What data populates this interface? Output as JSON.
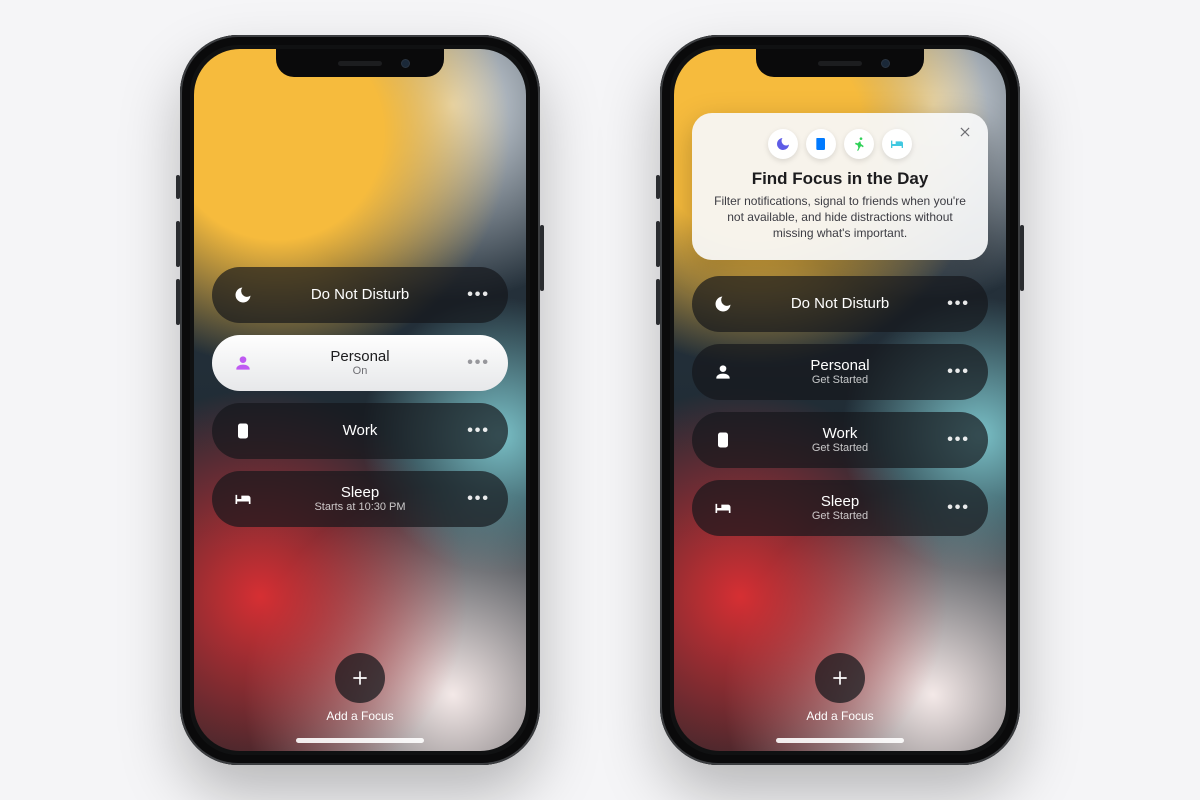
{
  "left": {
    "items": [
      {
        "title": "Do Not Disturb",
        "sub": ""
      },
      {
        "title": "Personal",
        "sub": "On"
      },
      {
        "title": "Work",
        "sub": ""
      },
      {
        "title": "Sleep",
        "sub": "Starts at 10:30 PM"
      }
    ],
    "add": "Add a Focus"
  },
  "right": {
    "card": {
      "title": "Find Focus in the Day",
      "body": "Filter notifications, signal to friends when you're not available, and hide distractions without missing what's important."
    },
    "items": [
      {
        "title": "Do Not Disturb",
        "sub": ""
      },
      {
        "title": "Personal",
        "sub": "Get Started"
      },
      {
        "title": "Work",
        "sub": "Get Started"
      },
      {
        "title": "Sleep",
        "sub": "Get Started"
      }
    ],
    "add": "Add a Focus"
  }
}
